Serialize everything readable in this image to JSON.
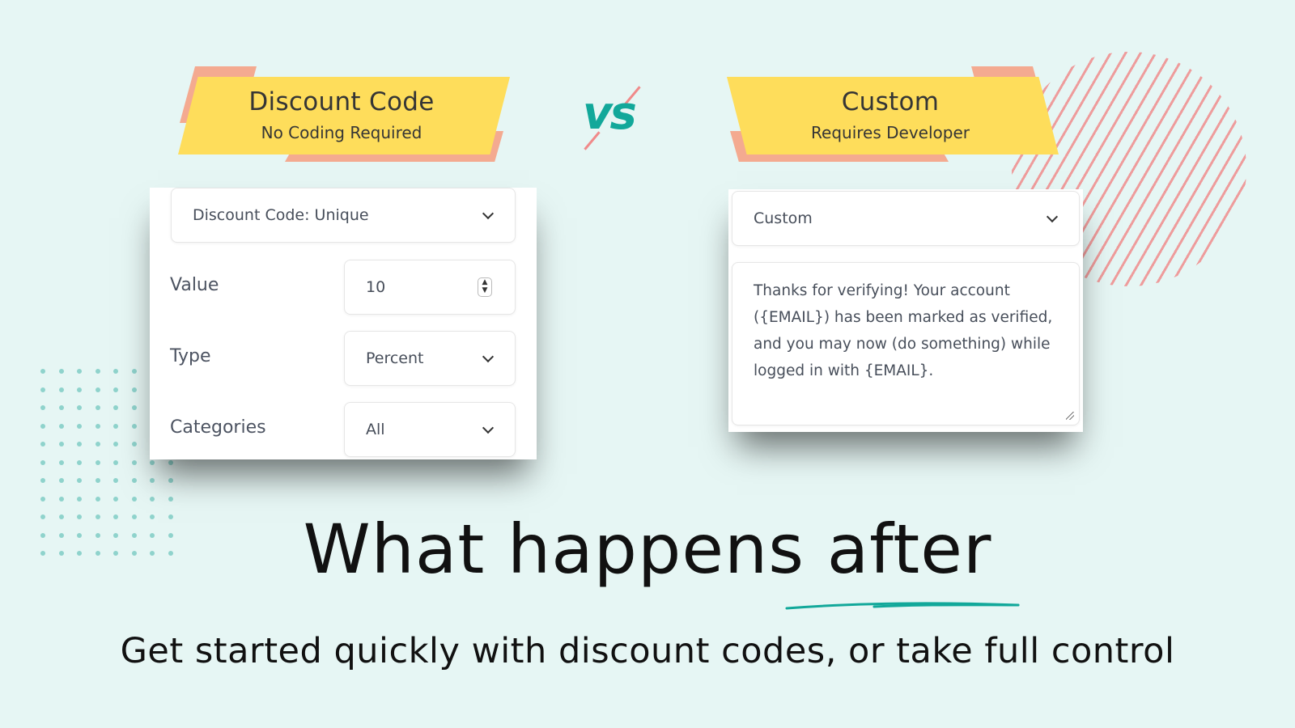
{
  "left_banner": {
    "title": "Discount Code",
    "subtitle": "No Coding Required"
  },
  "right_banner": {
    "title": "Custom",
    "subtitle": "Requires Developer"
  },
  "vs_label": "vs",
  "left_panel": {
    "type_select": "Discount Code: Unique",
    "value_label": "Value",
    "value_input": "10",
    "type_label": "Type",
    "type_value": "Percent",
    "categories_label": "Categories",
    "categories_value": "All"
  },
  "right_panel": {
    "select": "Custom",
    "message_lines": [
      "Thanks for verifying! Your account",
      "({EMAIL}) has been marked as verified,",
      "and you may now (do something) while",
      "logged in with {EMAIL}."
    ]
  },
  "headline": "What happens after",
  "subheadline": "Get started quickly with discount codes, or take full control",
  "colors": {
    "accent": "#12a89a",
    "banner": "#fedd5b",
    "banner_back": "#f4aa90",
    "background": "#e6f6f4"
  }
}
